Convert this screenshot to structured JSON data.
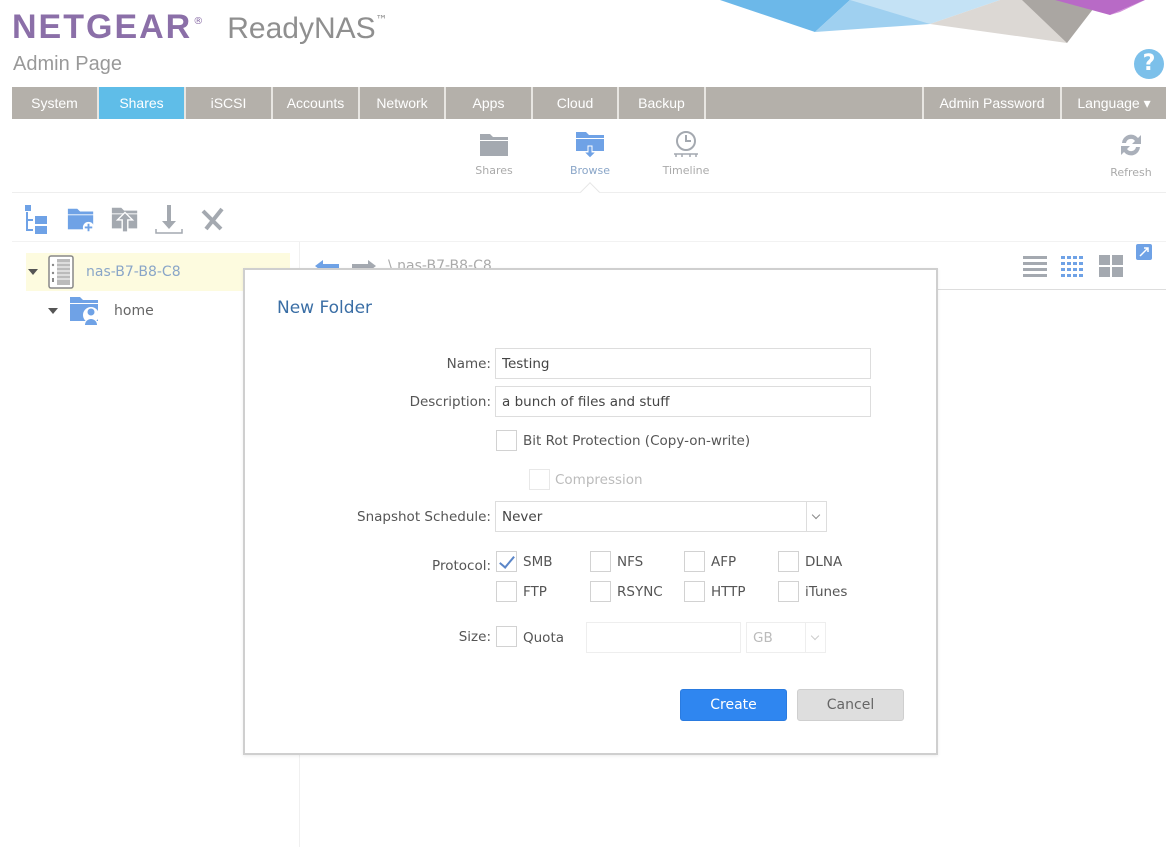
{
  "header": {
    "brand": "NETGEAR",
    "brand_reg": "®",
    "product": "ReadyNAS",
    "product_tm": "™",
    "subtitle": "Admin Page",
    "help_icon": "?"
  },
  "main_nav": {
    "tabs": [
      {
        "label": "System",
        "active": false
      },
      {
        "label": "Shares",
        "active": true
      },
      {
        "label": "iSCSI",
        "active": false
      },
      {
        "label": "Accounts",
        "active": false
      },
      {
        "label": "Network",
        "active": false
      },
      {
        "label": "Apps",
        "active": false
      },
      {
        "label": "Cloud",
        "active": false
      },
      {
        "label": "Backup",
        "active": false
      }
    ],
    "right_tabs": [
      {
        "label": "Admin Password"
      },
      {
        "label": "Language ▾"
      }
    ]
  },
  "sub_nav": {
    "items": [
      {
        "label": "Shares",
        "icon": "folder-icon",
        "active": false
      },
      {
        "label": "Browse",
        "icon": "browse-folder-icon",
        "active": true
      },
      {
        "label": "Timeline",
        "icon": "clock-icon",
        "active": false
      }
    ],
    "refresh_label": "Refresh"
  },
  "toolbar": {
    "tools": [
      "tree-view-icon",
      "new-folder-icon",
      "upload-icon",
      "download-icon",
      "delete-icon"
    ]
  },
  "tree": {
    "root": {
      "label": "nas-B7-B8-C8",
      "selected": true,
      "expanded": true
    },
    "children": [
      {
        "label": "home",
        "expanded": true
      }
    ]
  },
  "browse": {
    "path": "\\ nas-B7-B8-C8",
    "view_modes": [
      "list-view-icon",
      "grid-view-icon",
      "tile-view-icon"
    ]
  },
  "colors": {
    "brand": "#8b6fa8",
    "nav_bg": "#b4b0aa",
    "nav_active": "#5fbde8",
    "accent_blue": "#2f86f0",
    "dialog_title": "#3a6ea5"
  },
  "dialog": {
    "title": "New Folder",
    "name_label": "Name:",
    "name_value": "Testing",
    "description_label": "Description:",
    "description_value": "a bunch of files and stuff",
    "bitrot_label": "Bit Rot Protection (Copy-on-write)",
    "bitrot_checked": false,
    "compression_label": "Compression",
    "compression_checked": false,
    "compression_enabled": false,
    "snapshot_label": "Snapshot Schedule:",
    "snapshot_value": "Never",
    "protocol_label": "Protocol:",
    "protocols": [
      {
        "label": "SMB",
        "checked": true
      },
      {
        "label": "NFS",
        "checked": false
      },
      {
        "label": "AFP",
        "checked": false
      },
      {
        "label": "DLNA",
        "checked": false
      },
      {
        "label": "FTP",
        "checked": false
      },
      {
        "label": "RSYNC",
        "checked": false
      },
      {
        "label": "HTTP",
        "checked": false
      },
      {
        "label": "iTunes",
        "checked": false
      }
    ],
    "size_label": "Size:",
    "quota_label": "Quota",
    "quota_checked": false,
    "quota_value": "",
    "quota_unit": "GB",
    "create_label": "Create",
    "cancel_label": "Cancel"
  }
}
